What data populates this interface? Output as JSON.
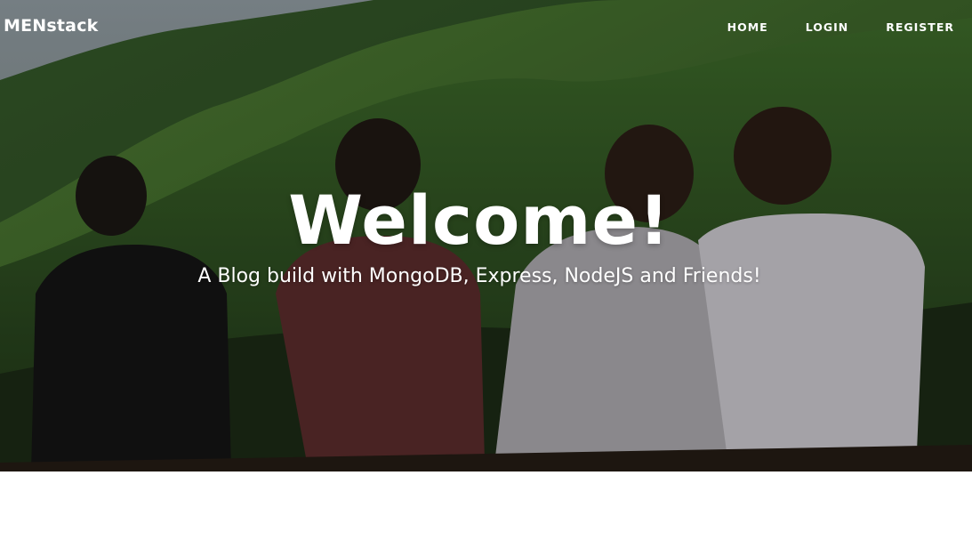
{
  "navbar": {
    "brand": "MENstack",
    "links": [
      {
        "label": "HOME"
      },
      {
        "label": "LOGIN"
      },
      {
        "label": "REGISTER"
      }
    ]
  },
  "hero": {
    "title": "Welcome!",
    "subtitle": "A Blog build with MongoDB, Express, NodeJS and Friends!",
    "image_description_colors": {
      "mountain_green": "#3f6b2a",
      "overlay": "rgba(0,0,0,0.35)"
    }
  },
  "colors": {
    "text_light": "#ffffff",
    "page_background": "#ffffff"
  }
}
